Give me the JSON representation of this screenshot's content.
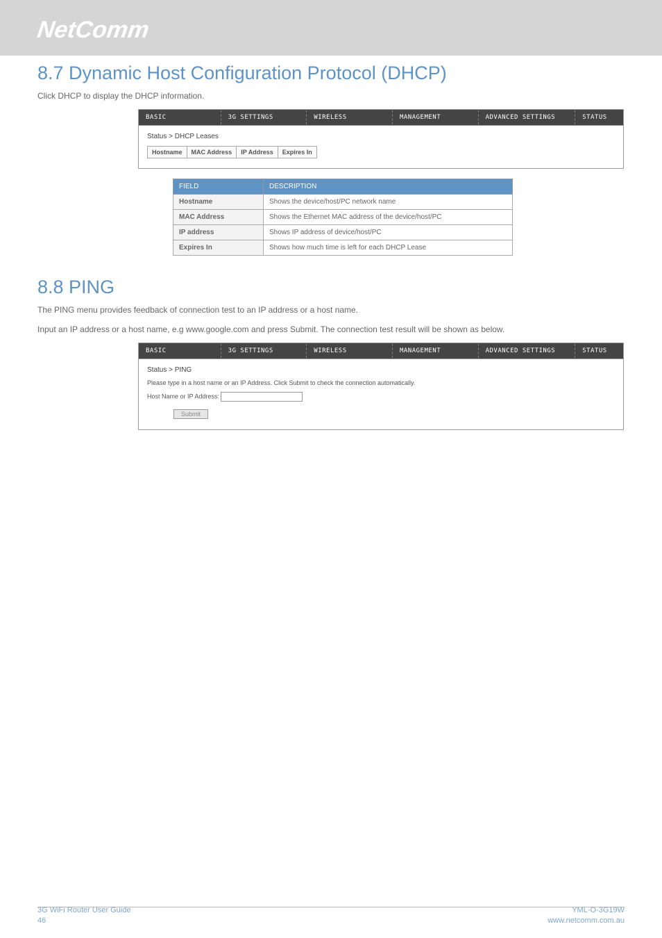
{
  "logo": "NetComm",
  "section_87": {
    "heading": "8.7 Dynamic Host Configuration Protocol (DHCP)",
    "intro": "Click DHCP to display the DHCP information.",
    "nav": [
      "BASIC",
      "3G SETTINGS",
      "WIRELESS",
      "MANAGEMENT",
      "ADVANCED SETTINGS",
      "STATUS"
    ],
    "breadcrumb": "Status > DHCP Leases",
    "leases_cols": [
      "Hostname",
      "MAC Address",
      "IP Address",
      "Expires In"
    ],
    "fields_header": [
      "FIELD",
      "DESCRIPTION"
    ],
    "fields": [
      {
        "name": "Hostname",
        "desc": "Shows the device/host/PC network name"
      },
      {
        "name": "MAC Address",
        "desc": "Shows the Ethernet MAC address of the device/host/PC"
      },
      {
        "name": "IP address",
        "desc": "Shows IP address of device/host/PC"
      },
      {
        "name": "Expires In",
        "desc": "Shows how much time is left for each DHCP Lease"
      }
    ]
  },
  "section_88": {
    "heading": "8.8 PING",
    "line1": "The PING menu provides feedback of connection test to an IP address or a host name.",
    "line2": "Input an IP address or a host name, e.g www.google.com and press Submit. The connection test result will be shown as below.",
    "nav": [
      "BASIC",
      "3G SETTINGS",
      "WIRELESS",
      "MANAGEMENT",
      "ADVANCED SETTINGS",
      "STATUS"
    ],
    "breadcrumb": "Status > PING",
    "instruction": "Please type in a host name or an IP Address. Click Submit to check the connection automatically.",
    "input_label": "Host Name or IP Address:",
    "input_value": "",
    "submit_label": "Submit"
  },
  "footer": {
    "left_title": "3G WiFi Router User Guide",
    "page": "46",
    "model": "YML-O-3G19W",
    "url": "www.netcomm.com.au"
  }
}
